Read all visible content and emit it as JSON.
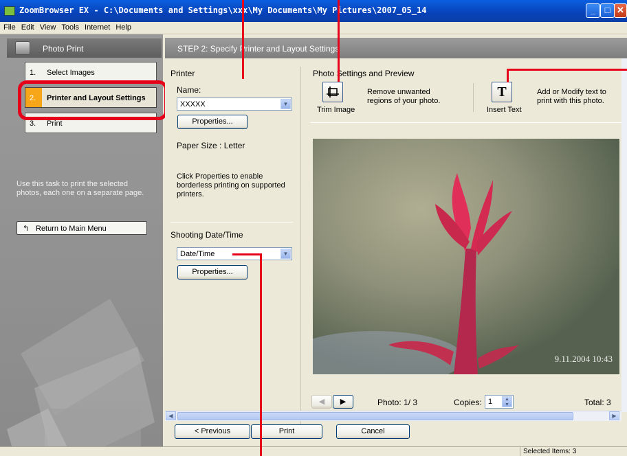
{
  "window": {
    "title": "ZoomBrowser EX  -  C:\\Documents and Settings\\xxx\\My Documents\\My Pictures\\2007_05_14"
  },
  "menu": [
    "File",
    "Edit",
    "View",
    "Tools",
    "Internet",
    "Help"
  ],
  "left": {
    "header": "Photo Print",
    "steps": [
      {
        "num": "1.",
        "label": "Select Images"
      },
      {
        "num": "2.",
        "label": "Printer and Layout Settings"
      },
      {
        "num": "3.",
        "label": "Print"
      }
    ],
    "help": "Use this task to print the selected photos, each one on a separate page.",
    "return_label": "Return to Main Menu"
  },
  "step_header": "STEP 2: Specify Printer and Layout Settings",
  "printer": {
    "section": "Printer",
    "name_label": "Name:",
    "name_value": "XXXXX",
    "properties": "Properties...",
    "paper_size": "Paper Size : Letter",
    "note": "Click Properties to enable borderless printing on supported printers."
  },
  "shooting": {
    "section": "Shooting Date/Time",
    "value": "Date/Time",
    "properties": "Properties..."
  },
  "photo_settings": {
    "section": "Photo Settings and Preview",
    "trim_label": "Trim Image",
    "trim_desc": "Remove unwanted regions of your photo.",
    "text_icon": "T",
    "text_label": "Insert Text",
    "text_desc": "Add or Modify text to print with this photo."
  },
  "preview": {
    "stamp": "9.11.2004   10:43",
    "photo_label": "Photo: 1/ 3",
    "copies_label": "Copies:",
    "copies_value": "1",
    "total_label": "Total: 3"
  },
  "nav": {
    "previous": "< Previous",
    "print": "Print",
    "cancel": "Cancel"
  },
  "status": {
    "selected": "Selected Items: 3"
  },
  "colors": {
    "title_bar": "#0842b8",
    "active_step": "#f6a618",
    "callout": "#e6001a"
  }
}
